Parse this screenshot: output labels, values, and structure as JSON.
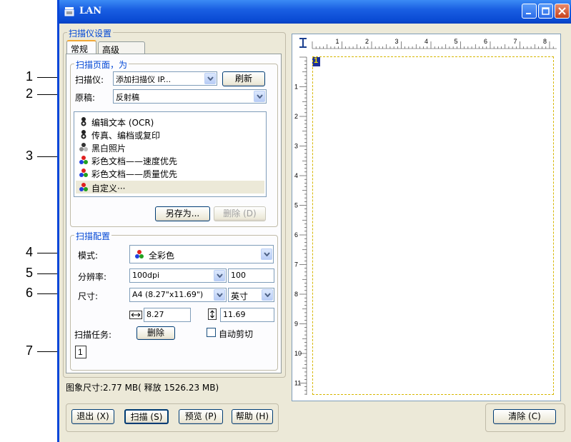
{
  "callouts": [
    "1",
    "2",
    "3",
    "4",
    "5",
    "6",
    "7"
  ],
  "window": {
    "title": "LAN"
  },
  "scanner_settings": {
    "legend": "扫描仪设置",
    "tabs": [
      {
        "label": "常规"
      },
      {
        "label": "高级"
      }
    ],
    "scan_page": {
      "legend": "扫描页面，为",
      "scanner_label": "扫描仪:",
      "scanner_value": "添加扫描仪 IP...",
      "refresh_label": "刷新",
      "original_label": "原稿:",
      "original_value": "反射稿",
      "presets": [
        {
          "label": "编辑文本 (OCR)",
          "icon": "bw-figure-icon"
        },
        {
          "label": "传真、编档或复印",
          "icon": "bw-figure-icon"
        },
        {
          "label": "黑白照片",
          "icon": "gray-figure-icon"
        },
        {
          "label": "彩色文档——速度优先",
          "icon": "color-figure-icon"
        },
        {
          "label": "彩色文档——质量优先",
          "icon": "color-figure-icon"
        },
        {
          "label": "自定义···",
          "icon": "color-figure-icon",
          "selected": true
        }
      ],
      "save_as_label": "另存为...",
      "delete_label": "删除 (D)"
    },
    "scan_config": {
      "legend": "扫描配置",
      "mode_label": "模式:",
      "mode_value": "全彩色",
      "resolution_label": "分辨率:",
      "resolution_value": "100dpi",
      "resolution_number": "100",
      "size_label": "尺寸:",
      "size_value": "A4 (8.27\"x11.69\")",
      "unit_value": "英寸",
      "width_value": "8.27",
      "height_value": "11.69",
      "task_label": "扫描任务:",
      "task_delete_label": "删除",
      "auto_crop_label": "自动剪切",
      "task_item": "1"
    }
  },
  "status_text": "图象尺寸:2.77 MB( 释放 1526.23 MB)",
  "buttons": {
    "exit": "退出 (X)",
    "scan": "扫描 (S)",
    "preview": "预览 (P)",
    "help": "帮助 (H)",
    "clear": "清除 (C)"
  },
  "preview": {
    "top_ruler_labels": [
      "1",
      "2",
      "3",
      "4",
      "5",
      "6",
      "7",
      "8"
    ],
    "left_ruler_labels": [
      "1",
      "2",
      "3",
      "4",
      "5",
      "6",
      "7",
      "8",
      "9",
      "10",
      "11"
    ],
    "page_marker": "1"
  },
  "colors": {
    "title_bar": "#0a4bd4",
    "legend_text": "#0046d5",
    "window_bg": "#ece9d8",
    "marquee": "#d6b600"
  }
}
